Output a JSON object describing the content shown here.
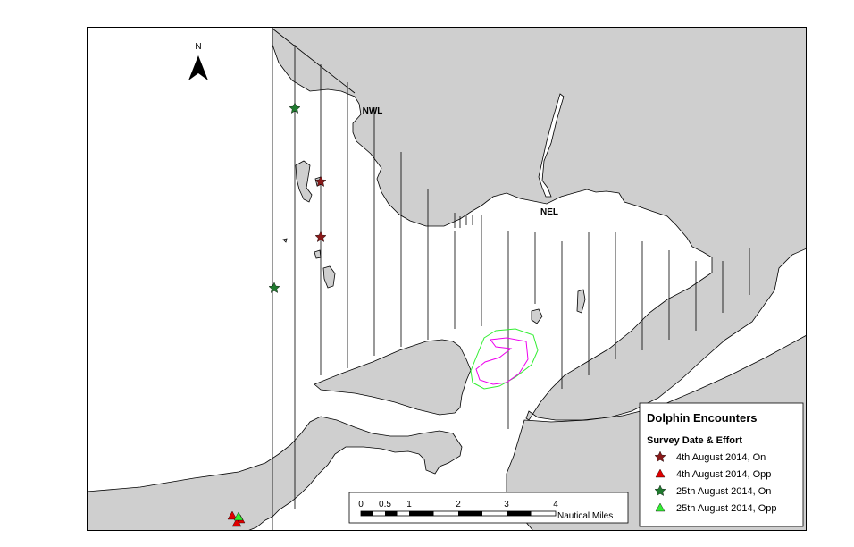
{
  "map": {
    "north_label": "N",
    "place_labels": {
      "nwl": "NWL",
      "nel": "NEL"
    }
  },
  "legend": {
    "title": "Dolphin Encounters",
    "subtitle": "Survey Date & Effort",
    "items": [
      {
        "label": "4th August 2014, On",
        "symbol": "star",
        "color": "#8b1a1a"
      },
      {
        "label": "4th August 2014, Opp",
        "symbol": "triangle",
        "color": "#e00000"
      },
      {
        "label": "25th August 2014, On",
        "symbol": "star",
        "color": "#1f7a2e"
      },
      {
        "label": "25th August 2014, Opp",
        "symbol": "triangle",
        "color": "#33ee33"
      }
    ]
  },
  "scale_bar": {
    "ticks": [
      "0",
      "0.5",
      "1",
      "2",
      "3",
      "4"
    ],
    "unit": "Nautical Miles"
  },
  "colors": {
    "land": "#cfcfcf",
    "water": "#ffffff",
    "outline": "#000000"
  }
}
